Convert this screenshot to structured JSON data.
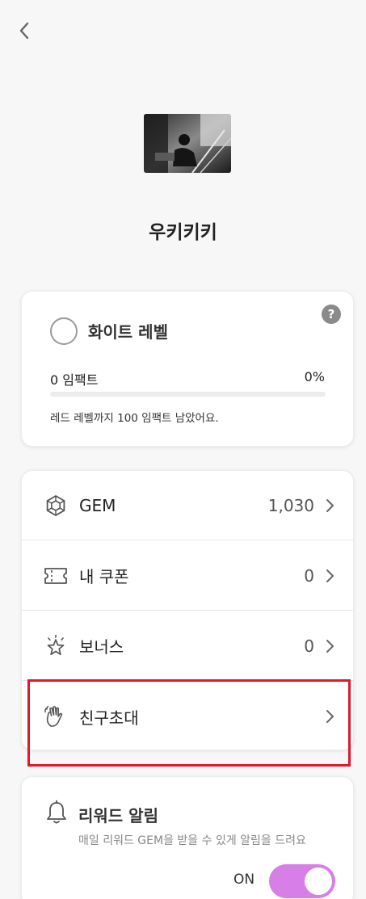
{
  "header": {
    "back_icon": "chevron-left-icon"
  },
  "profile": {
    "username": "우키키키"
  },
  "level_card": {
    "level_name": "화이트 레벨",
    "help_symbol": "?",
    "impact_label": "0 임팩트",
    "impact_percent_label": "0%",
    "progress_fraction": 0,
    "note": "레드 레벨까지 100 임팩트 남았어요."
  },
  "menu": {
    "items": [
      {
        "icon": "gem-icon",
        "label": "GEM",
        "value": "1,030"
      },
      {
        "icon": "ticket-icon",
        "label": "내 쿠폰",
        "value": "0"
      },
      {
        "icon": "star-sparkle-icon",
        "label": "보너스",
        "value": "0"
      },
      {
        "icon": "waving-hand-icon",
        "label": "친구초대",
        "value": ""
      }
    ]
  },
  "reward": {
    "title": "리워드 알림",
    "description": "매일 리워드 GEM을 받을 수 있게 알림을 드려요",
    "toggle_label": "ON",
    "toggle_on": true
  },
  "colors": {
    "toggle_on": "#d77fe6",
    "highlight": "#e0182a",
    "background": "#f7f7f7"
  }
}
